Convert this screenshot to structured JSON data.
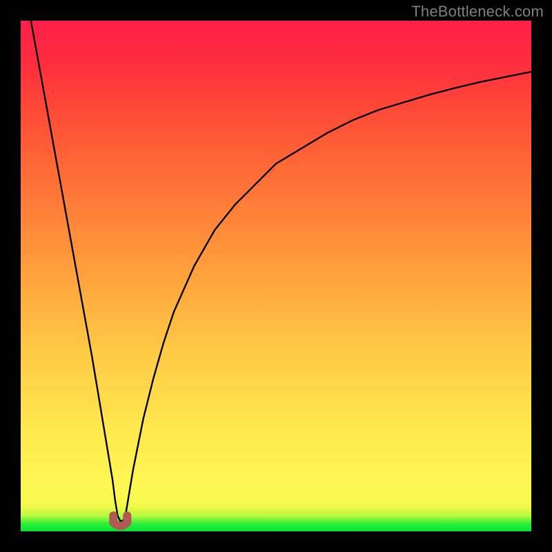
{
  "watermark": "TheBottleneck.com",
  "chart_data": {
    "type": "line",
    "title": "",
    "xlabel": "",
    "ylabel": "",
    "xlim": [
      0,
      100
    ],
    "ylim": [
      0,
      100
    ],
    "x": [
      2,
      4,
      6,
      8,
      10,
      12,
      14,
      15,
      16,
      17,
      18,
      18.5,
      19,
      19.5,
      20,
      20.5,
      21,
      22,
      24,
      26,
      28,
      30,
      34,
      38,
      42,
      46,
      50,
      55,
      60,
      65,
      70,
      75,
      80,
      85,
      90,
      95,
      100
    ],
    "y": [
      100,
      89,
      78,
      67,
      56,
      45,
      34,
      28,
      22,
      16,
      10,
      6,
      3,
      2,
      2,
      3,
      6,
      12,
      22,
      30,
      37,
      43,
      52,
      59,
      64,
      68,
      72,
      75,
      78,
      80.5,
      82.5,
      84,
      85.5,
      86.8,
      88,
      89,
      90
    ],
    "annotations": [
      {
        "type": "marker",
        "shape": "u-blob",
        "x": 19.5,
        "y": 2,
        "color": "#b05a52"
      }
    ],
    "background": {
      "type": "vertical-gradient",
      "stops": [
        {
          "pos": 0.0,
          "color": "#00e838"
        },
        {
          "pos": 0.05,
          "color": "#f3fa4a"
        },
        {
          "pos": 0.5,
          "color": "#ffa23c"
        },
        {
          "pos": 1.0,
          "color": "#ff1e49"
        }
      ]
    }
  }
}
